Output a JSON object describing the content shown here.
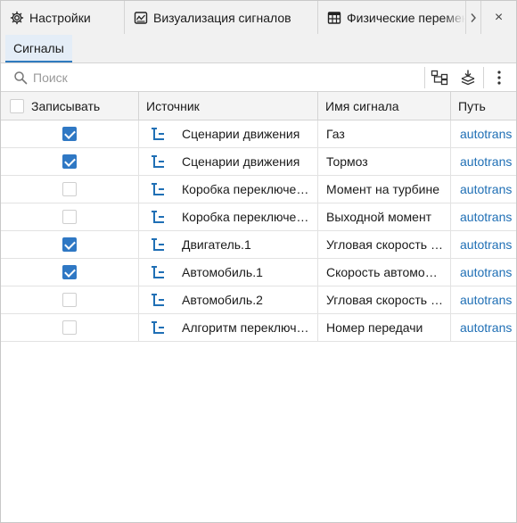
{
  "tabs": [
    {
      "label": "Настройки",
      "icon": "gear-icon"
    },
    {
      "label": "Визуализация сигналов",
      "icon": "signal-visualization-icon"
    },
    {
      "label": "Физические переменные",
      "icon": "table-icon"
    }
  ],
  "tab_scroll_icon": "chevron-right-icon",
  "close_label": "×",
  "subtab": {
    "label": "Сигналы"
  },
  "search": {
    "placeholder": "Поиск",
    "value": ""
  },
  "toolbar": {
    "icons": [
      "hierarchy-icon",
      "stack-download-icon",
      "more-vertical-icon"
    ]
  },
  "columns": {
    "record": "Записывать",
    "source": "Источник",
    "signal": "Имя сигнала",
    "path": "Путь"
  },
  "rows": [
    {
      "checked": true,
      "source": "Сценарии движения",
      "signal": "Газ",
      "path": "autotrans"
    },
    {
      "checked": true,
      "source": "Сценарии движения",
      "signal": "Тормоз",
      "path": "autotrans"
    },
    {
      "checked": false,
      "source": "Коробка переключения",
      "signal": "Момент на турбине",
      "path": "autotrans"
    },
    {
      "checked": false,
      "source": "Коробка переключения",
      "signal": "Выходной момент",
      "path": "autotrans"
    },
    {
      "checked": true,
      "source": "Двигатель.1",
      "signal": "Угловая скорость двигателя",
      "path": "autotrans"
    },
    {
      "checked": true,
      "source": "Автомобиль.1",
      "signal": "Скорость автомобиля",
      "path": "autotrans"
    },
    {
      "checked": false,
      "source": "Автомобиль.2",
      "signal": "Угловая скорость колеса",
      "path": "autotrans"
    },
    {
      "checked": false,
      "source": "Алгоритм переключения",
      "signal": "Номер передачи",
      "path": "autotrans"
    }
  ],
  "colors": {
    "accent": "#2f78c4",
    "link": "#1f6fb5",
    "source_icon": "#1f6fb5"
  }
}
